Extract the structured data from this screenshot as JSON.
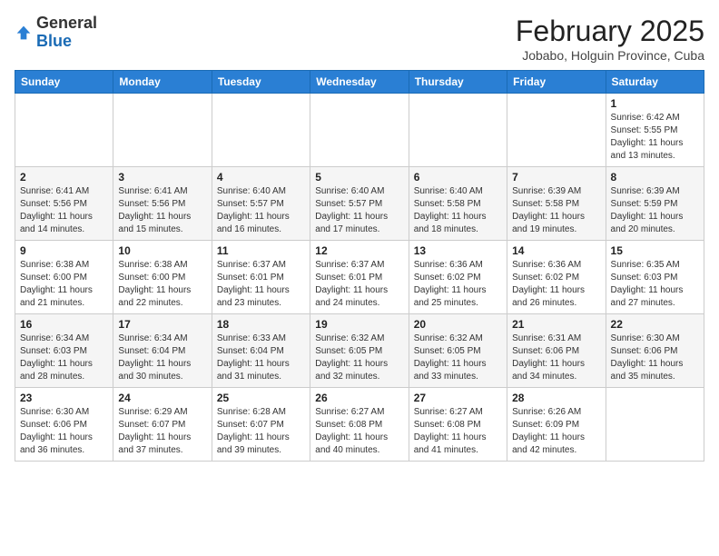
{
  "header": {
    "logo": {
      "general": "General",
      "blue": "Blue"
    },
    "title": "February 2025",
    "subtitle": "Jobabo, Holguin Province, Cuba"
  },
  "days_of_week": [
    "Sunday",
    "Monday",
    "Tuesday",
    "Wednesday",
    "Thursday",
    "Friday",
    "Saturday"
  ],
  "weeks": [
    [
      {
        "day": null,
        "info": null
      },
      {
        "day": null,
        "info": null
      },
      {
        "day": null,
        "info": null
      },
      {
        "day": null,
        "info": null
      },
      {
        "day": null,
        "info": null
      },
      {
        "day": null,
        "info": null
      },
      {
        "day": "1",
        "info": "Sunrise: 6:42 AM\nSunset: 5:55 PM\nDaylight: 11 hours\nand 13 minutes."
      }
    ],
    [
      {
        "day": "2",
        "info": "Sunrise: 6:41 AM\nSunset: 5:56 PM\nDaylight: 11 hours\nand 14 minutes."
      },
      {
        "day": "3",
        "info": "Sunrise: 6:41 AM\nSunset: 5:56 PM\nDaylight: 11 hours\nand 15 minutes."
      },
      {
        "day": "4",
        "info": "Sunrise: 6:40 AM\nSunset: 5:57 PM\nDaylight: 11 hours\nand 16 minutes."
      },
      {
        "day": "5",
        "info": "Sunrise: 6:40 AM\nSunset: 5:57 PM\nDaylight: 11 hours\nand 17 minutes."
      },
      {
        "day": "6",
        "info": "Sunrise: 6:40 AM\nSunset: 5:58 PM\nDaylight: 11 hours\nand 18 minutes."
      },
      {
        "day": "7",
        "info": "Sunrise: 6:39 AM\nSunset: 5:58 PM\nDaylight: 11 hours\nand 19 minutes."
      },
      {
        "day": "8",
        "info": "Sunrise: 6:39 AM\nSunset: 5:59 PM\nDaylight: 11 hours\nand 20 minutes."
      }
    ],
    [
      {
        "day": "9",
        "info": "Sunrise: 6:38 AM\nSunset: 6:00 PM\nDaylight: 11 hours\nand 21 minutes."
      },
      {
        "day": "10",
        "info": "Sunrise: 6:38 AM\nSunset: 6:00 PM\nDaylight: 11 hours\nand 22 minutes."
      },
      {
        "day": "11",
        "info": "Sunrise: 6:37 AM\nSunset: 6:01 PM\nDaylight: 11 hours\nand 23 minutes."
      },
      {
        "day": "12",
        "info": "Sunrise: 6:37 AM\nSunset: 6:01 PM\nDaylight: 11 hours\nand 24 minutes."
      },
      {
        "day": "13",
        "info": "Sunrise: 6:36 AM\nSunset: 6:02 PM\nDaylight: 11 hours\nand 25 minutes."
      },
      {
        "day": "14",
        "info": "Sunrise: 6:36 AM\nSunset: 6:02 PM\nDaylight: 11 hours\nand 26 minutes."
      },
      {
        "day": "15",
        "info": "Sunrise: 6:35 AM\nSunset: 6:03 PM\nDaylight: 11 hours\nand 27 minutes."
      }
    ],
    [
      {
        "day": "16",
        "info": "Sunrise: 6:34 AM\nSunset: 6:03 PM\nDaylight: 11 hours\nand 28 minutes."
      },
      {
        "day": "17",
        "info": "Sunrise: 6:34 AM\nSunset: 6:04 PM\nDaylight: 11 hours\nand 30 minutes."
      },
      {
        "day": "18",
        "info": "Sunrise: 6:33 AM\nSunset: 6:04 PM\nDaylight: 11 hours\nand 31 minutes."
      },
      {
        "day": "19",
        "info": "Sunrise: 6:32 AM\nSunset: 6:05 PM\nDaylight: 11 hours\nand 32 minutes."
      },
      {
        "day": "20",
        "info": "Sunrise: 6:32 AM\nSunset: 6:05 PM\nDaylight: 11 hours\nand 33 minutes."
      },
      {
        "day": "21",
        "info": "Sunrise: 6:31 AM\nSunset: 6:06 PM\nDaylight: 11 hours\nand 34 minutes."
      },
      {
        "day": "22",
        "info": "Sunrise: 6:30 AM\nSunset: 6:06 PM\nDaylight: 11 hours\nand 35 minutes."
      }
    ],
    [
      {
        "day": "23",
        "info": "Sunrise: 6:30 AM\nSunset: 6:06 PM\nDaylight: 11 hours\nand 36 minutes."
      },
      {
        "day": "24",
        "info": "Sunrise: 6:29 AM\nSunset: 6:07 PM\nDaylight: 11 hours\nand 37 minutes."
      },
      {
        "day": "25",
        "info": "Sunrise: 6:28 AM\nSunset: 6:07 PM\nDaylight: 11 hours\nand 39 minutes."
      },
      {
        "day": "26",
        "info": "Sunrise: 6:27 AM\nSunset: 6:08 PM\nDaylight: 11 hours\nand 40 minutes."
      },
      {
        "day": "27",
        "info": "Sunrise: 6:27 AM\nSunset: 6:08 PM\nDaylight: 11 hours\nand 41 minutes."
      },
      {
        "day": "28",
        "info": "Sunrise: 6:26 AM\nSunset: 6:09 PM\nDaylight: 11 hours\nand 42 minutes."
      },
      {
        "day": null,
        "info": null
      }
    ]
  ]
}
